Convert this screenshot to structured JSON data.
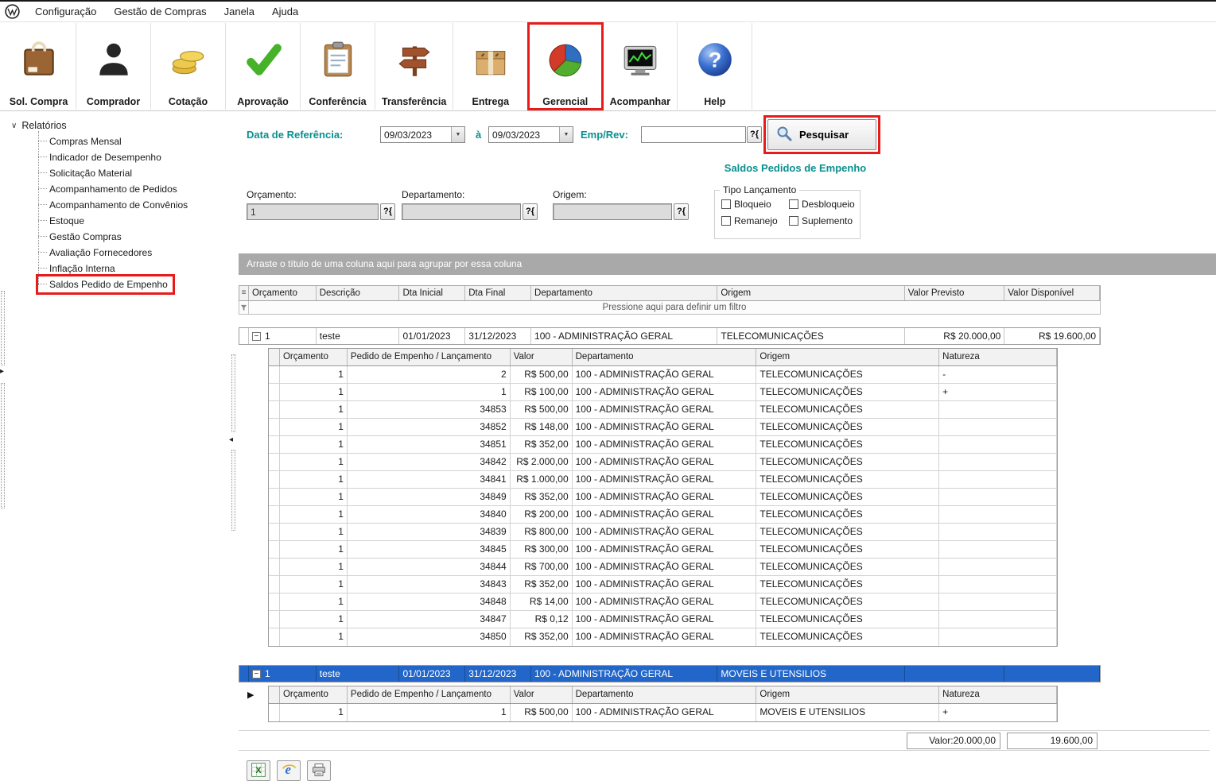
{
  "colors": {
    "accent_teal": "#0A8F8F",
    "annotation_red": "#E81B1B",
    "selection_blue": "#2166C8"
  },
  "menubar": {
    "items": [
      "Configuração",
      "Gestão de Compras",
      "Janela",
      "Ajuda"
    ]
  },
  "toolbar": {
    "buttons": [
      {
        "label": "Sol. Compra",
        "icon": "shopping-bag-icon"
      },
      {
        "label": "Comprador",
        "icon": "buyer-person-icon"
      },
      {
        "label": "Cotação",
        "icon": "coins-icon"
      },
      {
        "label": "Aprovação",
        "icon": "green-check-icon"
      },
      {
        "label": "Conferência",
        "icon": "clipboard-icon"
      },
      {
        "label": "Transferência",
        "icon": "signpost-icon"
      },
      {
        "label": "Entrega",
        "icon": "package-box-icon"
      },
      {
        "label": "Gerencial",
        "icon": "pie-chart-icon",
        "highlighted": true
      },
      {
        "label": "Acompanhar",
        "icon": "monitor-chart-icon"
      },
      {
        "label": "Help",
        "icon": "help-sphere-icon"
      }
    ]
  },
  "sidebar": {
    "root_label": "Relatórios",
    "items": [
      "Compras Mensal",
      "Indicador de Desempenho",
      "Solicitação Material",
      "Acompanhamento de Pedidos",
      "Acompanhamento de Convênios",
      "Estoque",
      "Gestão Compras",
      "Avaliação Fornecedores",
      "Inflação Interna",
      "Saldos Pedido de Empenho"
    ],
    "highlighted_index": 9
  },
  "filters": {
    "date_label": "Data de Referência:",
    "date_from": "09/03/2023",
    "to_label": "à",
    "date_to": "09/03/2023",
    "emp_rev_label": "Emp/Rev:",
    "emp_rev_value": "",
    "lookup_label": "?{",
    "search_label": "Pesquisar",
    "orcamento_label": "Orçamento:",
    "orcamento_value": "1",
    "departamento_label": "Departamento:",
    "departamento_value": "",
    "origem_label": "Origem:",
    "origem_value": "",
    "tipo_lancamento": {
      "label": "Tipo Lançamento",
      "options": [
        "Bloqueio",
        "Desbloqueio",
        "Remanejo",
        "Suplemento"
      ],
      "checked": [
        false,
        false,
        false,
        false
      ]
    }
  },
  "report_title": "Saldos Pedidos de Empenho",
  "grid": {
    "group_hint": "Arraste o título de uma coluna aqui para agrupar por essa coluna",
    "filter_hint": "Pressione aqui para definir um filtro",
    "columns": [
      "Orçamento",
      "Descrição",
      "Dta Inicial",
      "Dta Final",
      "Departamento",
      "Origem",
      "Valor Previsto",
      "Valor Disponível"
    ],
    "detail_columns": [
      "Orçamento",
      "Pedido de Empenho / Lançamento",
      "Valor",
      "Departamento",
      "Origem",
      "Natureza"
    ],
    "groups": [
      {
        "selected": false,
        "marker": false,
        "master": [
          "1",
          "teste",
          "01/01/2023",
          "31/12/2023",
          "100 - ADMINISTRAÇÃO GERAL",
          "TELECOMUNICAÇÕES",
          "R$ 20.000,00",
          "R$ 19.600,00"
        ],
        "rows": [
          [
            "1",
            "2",
            "R$ 500,00",
            "100 - ADMINISTRAÇÃO GERAL",
            "TELECOMUNICAÇÕES",
            "-"
          ],
          [
            "1",
            "1",
            "R$ 100,00",
            "100 - ADMINISTRAÇÃO GERAL",
            "TELECOMUNICAÇÕES",
            "+"
          ],
          [
            "1",
            "34853",
            "R$ 500,00",
            "100 - ADMINISTRAÇÃO GERAL",
            "TELECOMUNICAÇÕES",
            ""
          ],
          [
            "1",
            "34852",
            "R$ 148,00",
            "100 - ADMINISTRAÇÃO GERAL",
            "TELECOMUNICAÇÕES",
            ""
          ],
          [
            "1",
            "34851",
            "R$ 352,00",
            "100 - ADMINISTRAÇÃO GERAL",
            "TELECOMUNICAÇÕES",
            ""
          ],
          [
            "1",
            "34842",
            "R$ 2.000,00",
            "100 - ADMINISTRAÇÃO GERAL",
            "TELECOMUNICAÇÕES",
            ""
          ],
          [
            "1",
            "34841",
            "R$ 1.000,00",
            "100 - ADMINISTRAÇÃO GERAL",
            "TELECOMUNICAÇÕES",
            ""
          ],
          [
            "1",
            "34849",
            "R$ 352,00",
            "100 - ADMINISTRAÇÃO GERAL",
            "TELECOMUNICAÇÕES",
            ""
          ],
          [
            "1",
            "34840",
            "R$ 200,00",
            "100 - ADMINISTRAÇÃO GERAL",
            "TELECOMUNICAÇÕES",
            ""
          ],
          [
            "1",
            "34839",
            "R$ 800,00",
            "100 - ADMINISTRAÇÃO GERAL",
            "TELECOMUNICAÇÕES",
            ""
          ],
          [
            "1",
            "34845",
            "R$ 300,00",
            "100 - ADMINISTRAÇÃO GERAL",
            "TELECOMUNICAÇÕES",
            ""
          ],
          [
            "1",
            "34844",
            "R$ 700,00",
            "100 - ADMINISTRAÇÃO GERAL",
            "TELECOMUNICAÇÕES",
            ""
          ],
          [
            "1",
            "34843",
            "R$ 352,00",
            "100 - ADMINISTRAÇÃO GERAL",
            "TELECOMUNICAÇÕES",
            ""
          ],
          [
            "1",
            "34848",
            "R$ 14,00",
            "100 - ADMINISTRAÇÃO GERAL",
            "TELECOMUNICAÇÕES",
            ""
          ],
          [
            "1",
            "34847",
            "R$ 0,12",
            "100 - ADMINISTRAÇÃO GERAL",
            "TELECOMUNICAÇÕES",
            ""
          ],
          [
            "1",
            "34850",
            "R$ 352,00",
            "100 - ADMINISTRAÇÃO GERAL",
            "TELECOMUNICAÇÕES",
            ""
          ]
        ]
      },
      {
        "selected": true,
        "marker": true,
        "master": [
          "1",
          "teste",
          "01/01/2023",
          "31/12/2023",
          "100 - ADMINISTRAÇÃO GERAL",
          "MOVEIS E UTENSILIOS",
          "",
          ""
        ],
        "rows": [
          [
            "1",
            "1",
            "R$ 500,00",
            "100 - ADMINISTRAÇÃO GERAL",
            "MOVEIS E UTENSILIOS",
            "+"
          ]
        ]
      }
    ],
    "footer": {
      "valor_previsto": "Valor:20.000,00",
      "valor_disponivel": "19.600,00"
    }
  },
  "bottom_toolbar": {
    "icons": [
      "excel-export-icon",
      "internet-export-icon",
      "print-icon"
    ]
  }
}
